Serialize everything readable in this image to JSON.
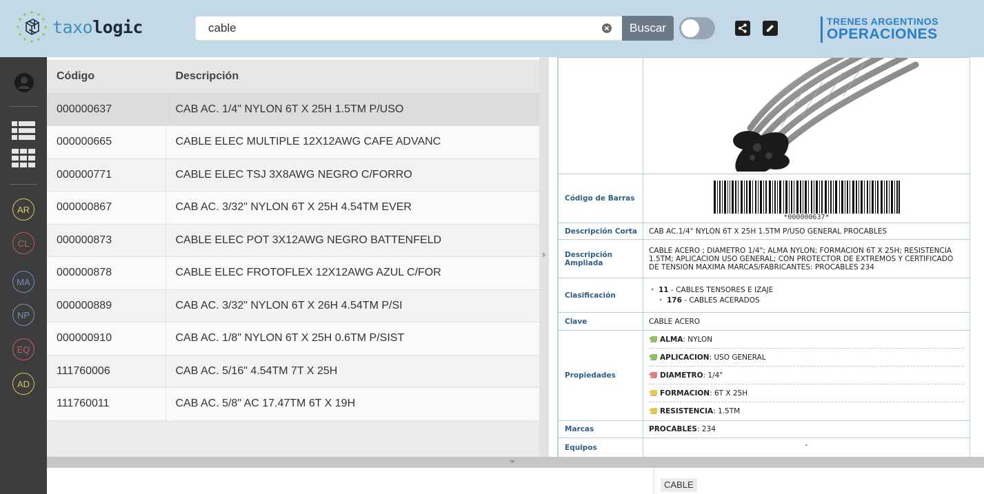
{
  "header": {
    "logo": {
      "part1": "taxo",
      "part2": "logic"
    },
    "search": {
      "value": "cable",
      "button_label": "Buscar"
    },
    "brand": {
      "top": "TRENES ARGENTINOS",
      "bottom": "OPERACIONES"
    },
    "colors": {
      "header_bg": "#c4d9e7",
      "brand": "#2a7fc6",
      "search_button": "#6b7a86"
    }
  },
  "sidebar": {
    "icons": [
      "user-icon",
      "list-view-icon",
      "grid-view-icon"
    ],
    "circles": [
      {
        "label": "AR",
        "color": "#d8c96a"
      },
      {
        "label": "CL",
        "color": "#c45c5c"
      },
      {
        "label": "MA",
        "color": "#6f8fc9"
      },
      {
        "label": "NP",
        "color": "#7d8fb6"
      },
      {
        "label": "EQ",
        "color": "#c45c6e"
      },
      {
        "label": "AD",
        "color": "#d8c15a"
      }
    ]
  },
  "table": {
    "headers": {
      "code": "Código",
      "desc": "Descripción"
    },
    "rows": [
      {
        "code": "000000637",
        "desc": "CAB AC. 1/4\" NYLON 6T X 25H 1.5TM P/USO"
      },
      {
        "code": "000000665",
        "desc": "CABLE ELEC MULTIPLE 12X12AWG CAFE ADVANC"
      },
      {
        "code": "000000771",
        "desc": "CABLE ELEC TSJ 3X8AWG NEGRO C/FORRO"
      },
      {
        "code": "000000867",
        "desc": "CAB AC. 3/32\" NYLON 6T X 25H 4.54TM EVER"
      },
      {
        "code": "000000873",
        "desc": "CABLE ELEC POT 3X12AWG NEGRO BATTENFELD"
      },
      {
        "code": "000000878",
        "desc": "CABLE ELEC FROTOFLEX 12X12AWG AZUL C/FOR"
      },
      {
        "code": "000000889",
        "desc": "CAB AC. 3/32\" NYLON 6T X 26H 4.54TM P/SI"
      },
      {
        "code": "000000910",
        "desc": "CAB AC. 1/8\" NYLON 6T X 25H 0.6TM P/SIST"
      },
      {
        "code": "111760006",
        "desc": "CAB AC. 5/16\" 4.54TM 7T X 25H"
      },
      {
        "code": "111760011",
        "desc": "CAB AC. 5/8\" AC 17.47TM 6T X 19H"
      }
    ]
  },
  "detail": {
    "barcode": {
      "label": "Código de Barras",
      "text": "*000000637*"
    },
    "short_desc": {
      "label": "Descripción Corta",
      "value": "CAB AC.1/4\" NYLON 6T X 25H 1.5TM P/USO GENERAL PROCABLES"
    },
    "long_desc": {
      "label": "Descripción Ampliada",
      "value": "CABLE ACERO ; DIAMETRO 1/4\"; ALMA NYLON; FORMACION 6T X 25H; RESISTENCIA 1.5TM; APLICACION USO GENERAL; CON PROTECTOR DE EXTREMOS Y CERTIFICADO DE TENSION MAXIMA MARCAS/FABRICANTES: PROCABLES 234"
    },
    "classification": {
      "label": "Clasificación",
      "items": [
        {
          "code": "11",
          "name": " - CABLES TENSORES E IZAJE"
        },
        {
          "code": "176",
          "name": " - CABLES ACERADOS"
        }
      ]
    },
    "key": {
      "label": "Clave",
      "value": "CABLE ACERO"
    },
    "properties": {
      "label": "Propiedades",
      "items": [
        {
          "name": "ALMA",
          "value": ": NYLON",
          "tag_color": "#8fbf5e"
        },
        {
          "name": "APLICACION",
          "value": ": USO GENERAL",
          "tag_color": "#8fbf5e"
        },
        {
          "name": "DIAMETRO",
          "value": ": 1/4\"",
          "tag_color": "#e07f7f"
        },
        {
          "name": "FORMACION",
          "value": ": 6T X 25H",
          "tag_color": "#e8c65c"
        },
        {
          "name": "RESISTENCIA",
          "value": ": 1.5TM",
          "tag_color": "#e8c65c"
        }
      ]
    },
    "brands": {
      "label": "Marcas",
      "name": "PROCABLES",
      "value": ": 234"
    },
    "equipment": {
      "label": "Equipos",
      "value": "-"
    }
  },
  "bottom": {
    "chip": "CABLE"
  }
}
